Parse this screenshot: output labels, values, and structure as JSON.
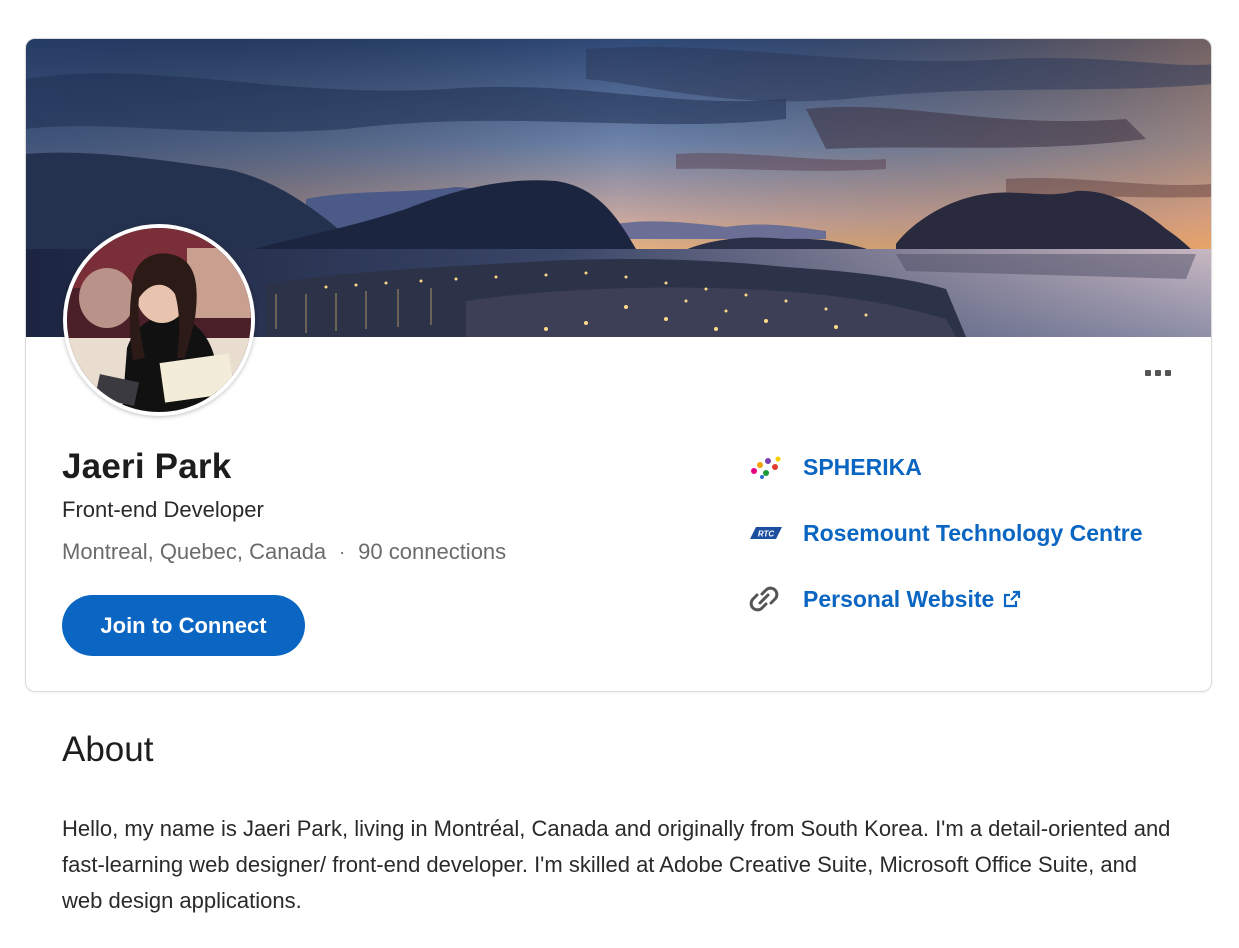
{
  "profile": {
    "name": "Jaeri Park",
    "headline": "Front-end Developer",
    "location": "Montreal, Quebec, Canada",
    "separator": "·",
    "connections": "90 connections",
    "join_label": "Join to Connect"
  },
  "links": [
    {
      "label": "SPHERIKA",
      "icon": "spherika-logo-icon"
    },
    {
      "label": "Rosemount Technology Centre",
      "icon": "rtc-logo-icon",
      "icon_text": "RTC"
    },
    {
      "label": "Personal Website",
      "icon": "link-chain-icon",
      "trailing_icon": "external-link-icon"
    }
  ],
  "about": {
    "title": "About",
    "text": "Hello, my name is Jaeri Park, living in Montréal, Canada and originally from South Korea. I'm a detail-oriented and fast-learning web designer/ front-end developer. I'm skilled at Adobe Creative Suite, Microsoft Office Suite, and web design applications."
  },
  "colors": {
    "brand_blue": "#0a66c2",
    "text_primary": "#1d1d1d",
    "text_secondary": "#6b6b6b"
  }
}
